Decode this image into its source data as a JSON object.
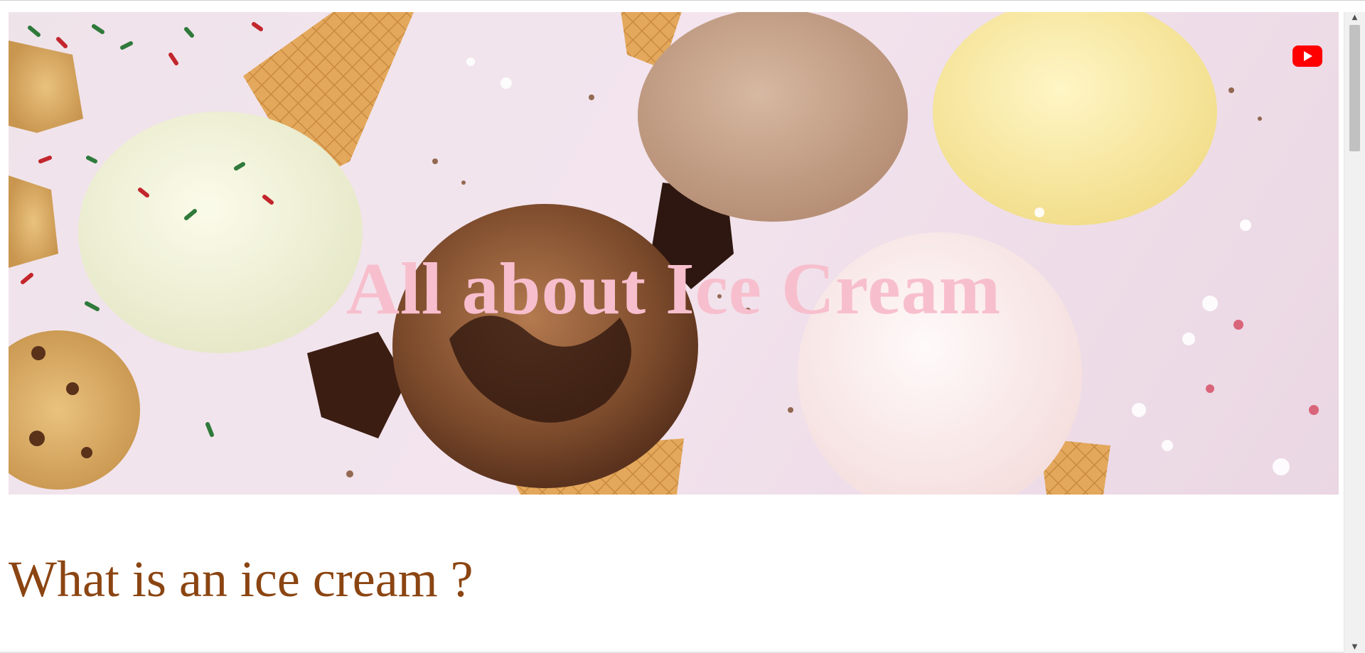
{
  "hero": {
    "title": "All about Ice Cream",
    "title_color": "#f7bfcd",
    "video_icon": "youtube-play-icon",
    "video_icon_color": "#ff0000"
  },
  "content": {
    "section_title": "What is an ice cream ?",
    "section_title_color": "#8b4512"
  },
  "scrollbar": {
    "up_icon": "scroll-up-arrow-icon",
    "down_icon": "scroll-down-arrow-icon",
    "up_glyph": "▲",
    "down_glyph": "▼"
  }
}
